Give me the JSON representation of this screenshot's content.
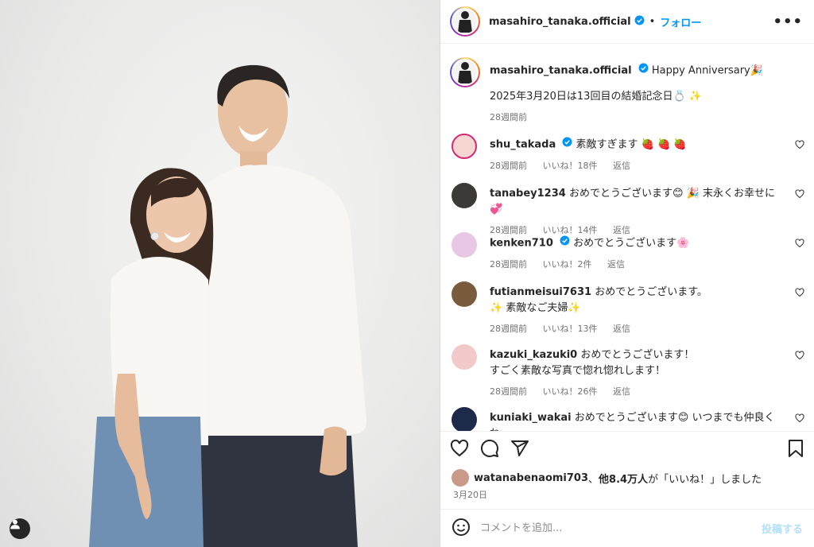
{
  "post": {
    "username": "masahiro_tanaka.official",
    "follow_label": "フォロー",
    "dot": "•",
    "more_label": "•••",
    "caption_tag": "Happy Anniversary🎉",
    "caption_text": "2025年3月20日は13回目の結婚記念日💍 ✨",
    "caption_time": "28週間前"
  },
  "comments": [
    {
      "user": "shu_takada",
      "verified": true,
      "text": "素敵すぎます 🍓 🍓 🍓",
      "time": "28週間前",
      "likes": "いいね！18件",
      "reply": "返信",
      "avatar_color": "#f6d6d0"
    },
    {
      "user": "tanabey1234",
      "verified": false,
      "text": "おめでとうございます😊 🎉 末永くお幸せに💞",
      "time": "28週間前",
      "likes": "いいね！14件",
      "reply": "返信",
      "avatar_color": "#3b3a36"
    },
    {
      "user": "kenken710",
      "verified": true,
      "text": "おめでとうございます🌸",
      "time": "28週間前",
      "likes": "いいね！2件",
      "reply": "返信",
      "avatar_color": "#e8c7e4"
    },
    {
      "user": "futianmeisui7631",
      "verified": false,
      "text": "おめでとうございます。",
      "text2": "✨ 素敵なご夫婦✨",
      "time": "28週間前",
      "likes": "いいね！13件",
      "reply": "返信",
      "avatar_color": "#7a5b3e"
    },
    {
      "user": "kazuki_kazuki0",
      "verified": false,
      "text": "おめでとうございます！",
      "text2": "すごく素敵な写真で惚れ惚れします！",
      "time": "28週間前",
      "likes": "いいね！26件",
      "reply": "返信",
      "avatar_color": "#f1c9c9"
    },
    {
      "user": "kuniaki_wakai",
      "verified": false,
      "text": "おめでとうございます😊 いつまでも仲良くねー",
      "text2": "❤️",
      "avatar_color": "#1d2a4a"
    }
  ],
  "likes": {
    "user": "watanabenaomi703",
    "text_mid": "、",
    "others": "他8.4万人",
    "text_end": "が「いいね！」しました",
    "avatar_color": "#c99a8a"
  },
  "date": "3月20日",
  "add_comment": {
    "placeholder": "コメントを追加...",
    "post_label": "投稿する"
  },
  "colors": {
    "accent": "#0095f6",
    "verified": "#0095f6",
    "muted": "#737373"
  },
  "icons": [
    "heart-icon",
    "comment-icon",
    "share-icon",
    "bookmark-icon",
    "emoji-icon",
    "more-icon",
    "verified-icon",
    "user-tag-icon"
  ]
}
